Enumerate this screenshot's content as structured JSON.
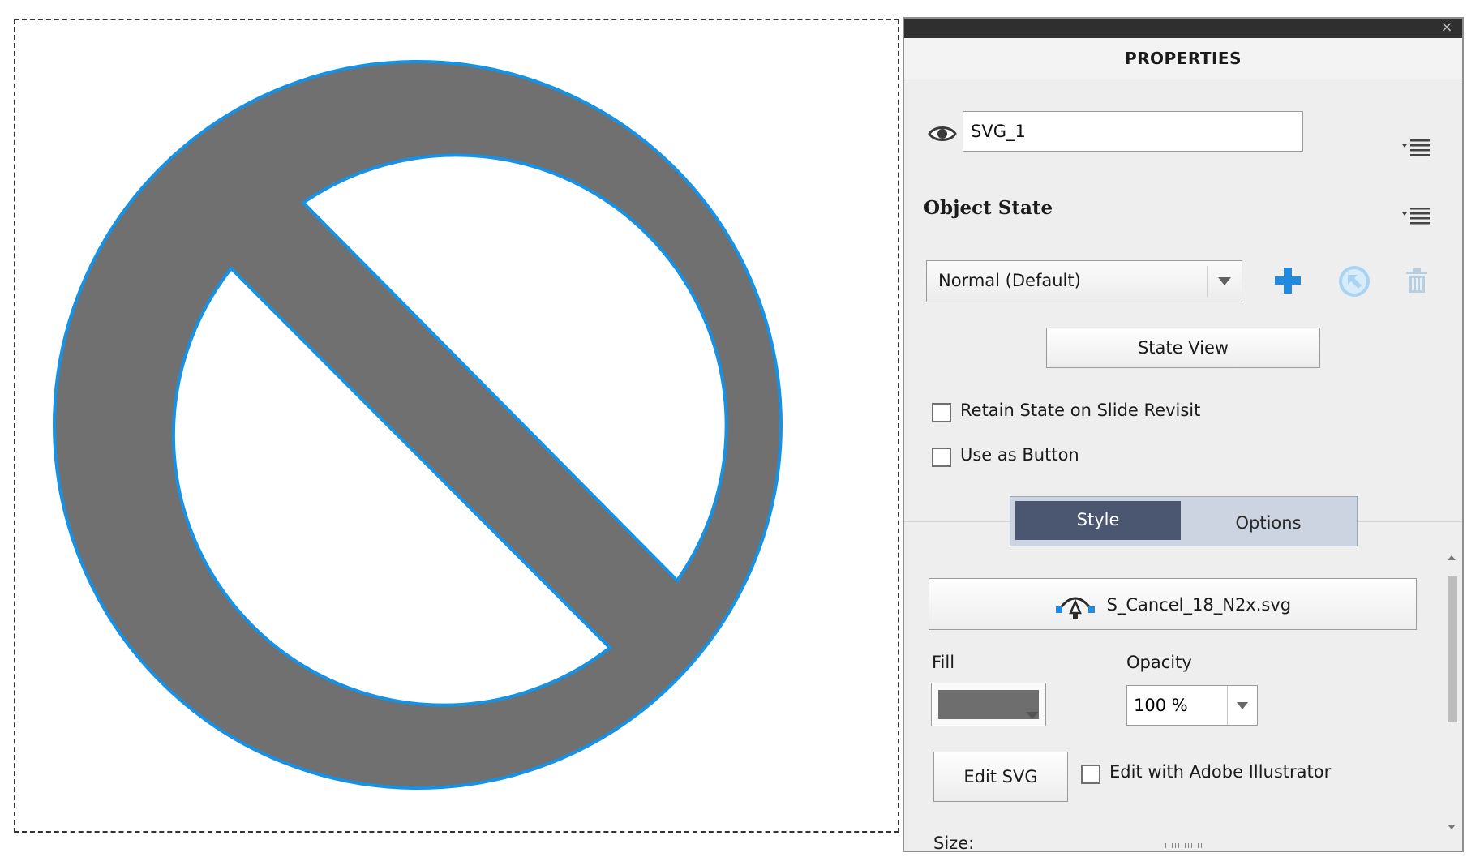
{
  "canvas": {
    "object_icon": "prohibited-circle-slash",
    "fill_color": "#707070",
    "stroke_color": "#1591e5"
  },
  "panel": {
    "title": "PROPERTIES",
    "close_icon": "close-x-icon",
    "object_name": "SVG_1",
    "object_state_label": "Object State",
    "state_select_value": "Normal (Default)",
    "state_view_label": "State View",
    "retain_state_label": "Retain State on Slide Revisit",
    "retain_state_checked": false,
    "use_as_button_label": "Use as Button",
    "use_as_button_checked": false,
    "tabs": [
      {
        "label": "Style",
        "active": true
      },
      {
        "label": "Options",
        "active": false
      }
    ],
    "svg_file_name": "S_Cancel_18_N2x.svg",
    "fill_label": "Fill",
    "fill_color": "#6e6e6e",
    "opacity_label": "Opacity",
    "opacity_value": "100 %",
    "edit_svg_label": "Edit SVG",
    "edit_illustrator_label": "Edit with Adobe Illustrator",
    "edit_illustrator_checked": false,
    "size_label": "Size:"
  },
  "colors": {
    "accent_blue": "#1f8ae0",
    "tab_active_bg": "#4b5670",
    "tab_bar_bg": "#ccd3e1"
  }
}
